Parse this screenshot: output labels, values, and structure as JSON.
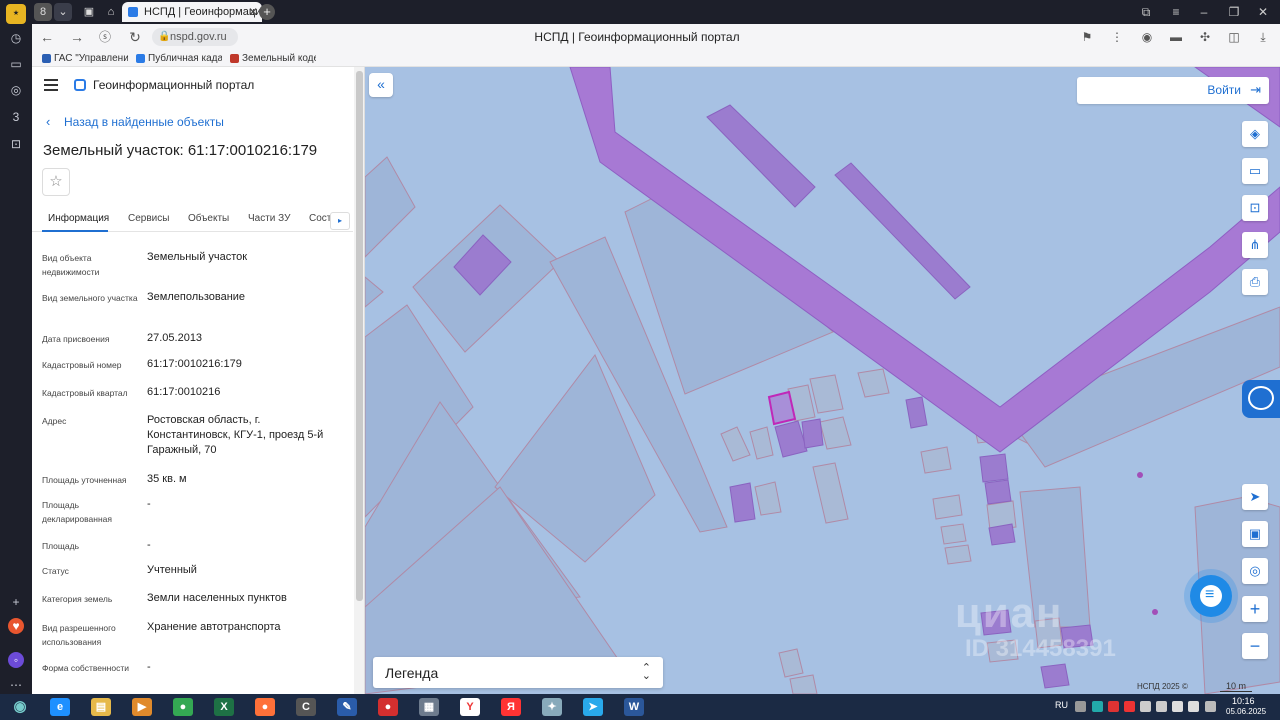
{
  "browser": {
    "tab_title": "НСПД | Геоинформацион",
    "tab_count_badge": "8",
    "url": "nspd.gov.ru",
    "page_title": "НСПД | Геоинформационный портал",
    "bookmarks": [
      {
        "label": "ГАС \"Управление",
        "color": "#2b5fb3"
      },
      {
        "label": "Публичная кадас",
        "color": "#2b7be6"
      },
      {
        "label": "Земельный кодек",
        "color": "#c0392b"
      }
    ]
  },
  "panel": {
    "portal_name": "Геоинформационный портал",
    "back_link": "Назад в найденные объекты",
    "title": "Земельный участок: 61:17:0010216:179",
    "star_glyph": "☆",
    "tabs": [
      "Информация",
      "Сервисы",
      "Объекты",
      "Части ЗУ",
      "Сост"
    ],
    "tabs_more_glyph": "▸",
    "rows": [
      {
        "label": "Вид объекта недвижимости",
        "value": "Земельный участок"
      },
      {
        "label": "Вид земельного участка",
        "value": "Землепользование"
      },
      {
        "label": "Дата присвоения",
        "value": "27.05.2013"
      },
      {
        "label": "Кадастровый номер",
        "value": "61:17:0010216:179"
      },
      {
        "label": "Кадастровый квартал",
        "value": "61:17:0010216"
      },
      {
        "label": "Адрес",
        "value": "Ростовская область, г. Константиновск, КГУ-1, проезд 5-й Гаражный, 70"
      },
      {
        "label": "Площадь уточненная",
        "value": "35 кв. м"
      },
      {
        "label": "Площадь декларированная",
        "value": "-"
      },
      {
        "label": "Площадь",
        "value": "-"
      },
      {
        "label": "Статус",
        "value": "Учтенный"
      },
      {
        "label": "Категория земель",
        "value": "Земли населенных пунктов"
      },
      {
        "label": "Вид разрешенного использования",
        "value": "Хранение автотранспорта"
      },
      {
        "label": "Форма собственности",
        "value": "-"
      }
    ]
  },
  "map": {
    "collapse_glyph": "«",
    "login_label": "Войти",
    "legend_label": "Легенда",
    "copyright": "НСПД 2025 ©",
    "scale": "10 m",
    "watermark": "циан",
    "watermark_id": "ID 314458391",
    "tools": [
      "layers-icon",
      "ruler-icon",
      "select-area-icon",
      "share-icon",
      "print-icon"
    ],
    "nav_tools": [
      "locate-icon",
      "minimap-icon",
      "geotag-icon"
    ]
  },
  "taskbar": {
    "lang": "RU",
    "time": "10:16",
    "date": "05.06.2025",
    "apps": [
      {
        "icon": "ie-icon",
        "color": "#1e90ff",
        "glyph": "e"
      },
      {
        "icon": "explorer-icon",
        "color": "#e6b94a",
        "glyph": "▤"
      },
      {
        "icon": "media-icon",
        "color": "#e08a2c",
        "glyph": "▶"
      },
      {
        "icon": "chrome-icon",
        "color": "#34a853",
        "glyph": "●"
      },
      {
        "icon": "excel-icon",
        "color": "#1e7145",
        "glyph": "X"
      },
      {
        "icon": "firefox-icon",
        "color": "#ff7139",
        "glyph": "●"
      },
      {
        "icon": "app-c-icon",
        "color": "#555",
        "glyph": "C"
      },
      {
        "icon": "app-blue-icon",
        "color": "#2a5caa",
        "glyph": "✎"
      },
      {
        "icon": "app-red-icon",
        "color": "#d32f2f",
        "glyph": "●"
      },
      {
        "icon": "app-gray-icon",
        "color": "#6d7b8d",
        "glyph": "▦"
      },
      {
        "icon": "yandex-browser-icon",
        "color": "#ffffff",
        "glyph": "Y"
      },
      {
        "icon": "yandex-icon",
        "color": "#f33",
        "glyph": "Я"
      },
      {
        "icon": "app-feather-icon",
        "color": "#8ab",
        "glyph": "✦"
      },
      {
        "icon": "telegram-icon",
        "color": "#29a9eb",
        "glyph": "➤"
      },
      {
        "icon": "word-icon",
        "color": "#2b579a",
        "glyph": "W"
      }
    ]
  }
}
